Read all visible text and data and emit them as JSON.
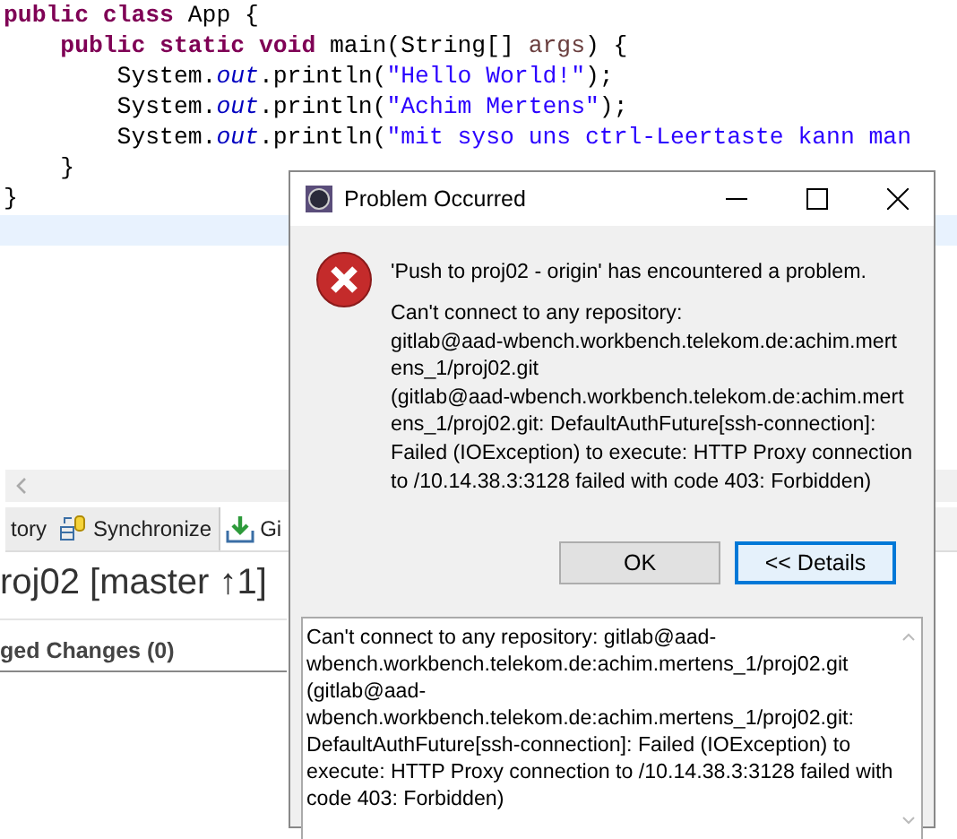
{
  "editor": {
    "lines": [
      {
        "current": false,
        "tokens": [
          {
            "kind": "keyword",
            "text": "public class"
          },
          {
            "kind": "plain",
            "text": " App {"
          }
        ]
      },
      {
        "current": false,
        "tokens": [
          {
            "kind": "keyword",
            "text": "    public static void"
          },
          {
            "kind": "plain",
            "text": " main(String[] "
          },
          {
            "kind": "param",
            "text": "args"
          },
          {
            "kind": "plain",
            "text": ") {"
          }
        ]
      },
      {
        "current": false,
        "tokens": [
          {
            "kind": "plain",
            "text": "        System."
          },
          {
            "kind": "field",
            "text": "out"
          },
          {
            "kind": "plain",
            "text": ".println("
          },
          {
            "kind": "string",
            "text": "\"Hello World!\""
          },
          {
            "kind": "plain",
            "text": ");"
          }
        ]
      },
      {
        "current": false,
        "tokens": [
          {
            "kind": "plain",
            "text": "        System."
          },
          {
            "kind": "field",
            "text": "out"
          },
          {
            "kind": "plain",
            "text": ".println("
          },
          {
            "kind": "string",
            "text": "\"Achim Mertens\""
          },
          {
            "kind": "plain",
            "text": ");"
          }
        ]
      },
      {
        "current": false,
        "tokens": [
          {
            "kind": "plain",
            "text": "        System."
          },
          {
            "kind": "field",
            "text": "out"
          },
          {
            "kind": "plain",
            "text": ".println("
          },
          {
            "kind": "string",
            "text": "\"mit syso uns ctrl-Leertaste kann man"
          }
        ]
      },
      {
        "current": false,
        "tokens": [
          {
            "kind": "plain",
            "text": "    }"
          }
        ]
      },
      {
        "current": false,
        "tokens": [
          {
            "kind": "plain",
            "text": "}"
          }
        ]
      },
      {
        "current": true
      }
    ]
  },
  "view_tabs": [
    {
      "label": "tory",
      "selected": false
    },
    {
      "label": "Synchronize",
      "selected": false
    },
    {
      "label": "Gi",
      "selected": true
    }
  ],
  "repository_title": "roj02 [master ↑1]",
  "section_header": "ged Changes (0)",
  "dialog": {
    "title": "Problem Occurred",
    "headline": "'Push to proj02 - origin' has encountered a problem.",
    "message_lines": [
      "Can't connect to any repository:",
      "gitlab@aad-wbench.workbench.telekom.de:achim.mert",
      "ens_1/proj02.git",
      "(gitlab@aad-wbench.workbench.telekom.de:achim.mert",
      "ens_1/proj02.git: DefaultAuthFuture[ssh-connection]:",
      "Failed (IOException) to execute: HTTP Proxy connection",
      "to /10.14.38.3:3128 failed with code 403: Forbidden)"
    ],
    "buttons": [
      {
        "label": "OK",
        "focused": false
      },
      {
        "label": "<< Details",
        "focused": true
      }
    ],
    "details_lines": [
      "Can't connect to any repository: gitlab@aad-",
      "wbench.workbench.telekom.de:achim.mertens_1/proj02.git",
      "(gitlab@aad-",
      "wbench.workbench.telekom.de:achim.mertens_1/proj02.git:",
      "DefaultAuthFuture[ssh-connection]: Failed (IOException) to",
      "execute: HTTP Proxy connection to /10.14.38.3:3128 failed with",
      "code 403: Forbidden)"
    ]
  }
}
